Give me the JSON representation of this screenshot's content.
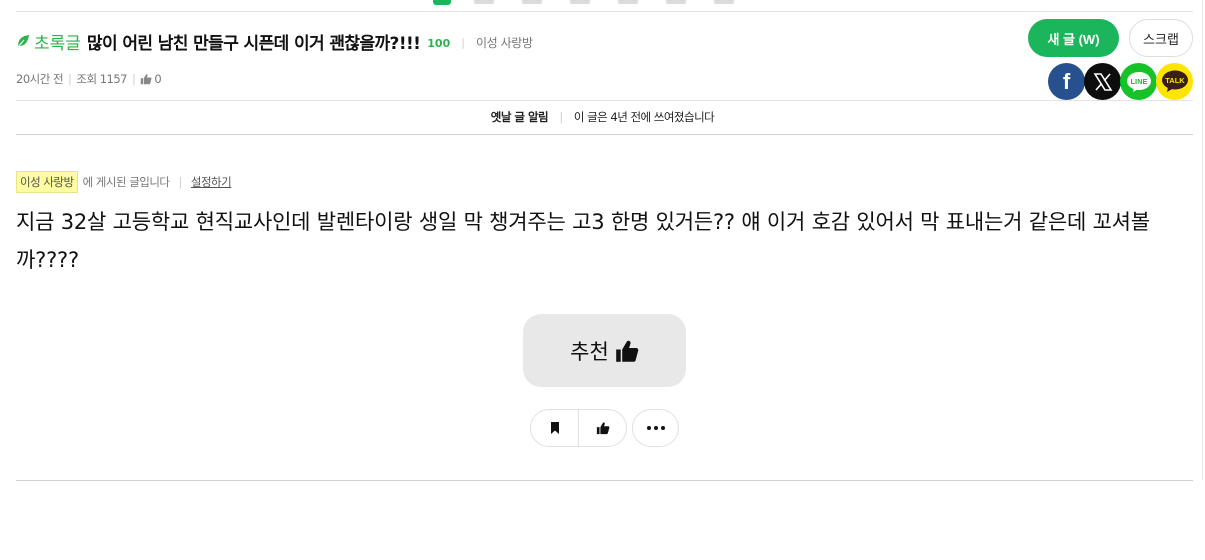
{
  "post": {
    "category": "초록글",
    "title": "많이 어린 남친 만들구 시픈데 이거 괜찮을까?!!!",
    "reply_count": "100",
    "board": "이성 사랑방",
    "time_ago": "20시간 전",
    "views": "조회 1157",
    "likes": "0"
  },
  "header_buttons": {
    "new_post": "새 글 (W)",
    "scrap": "스크랩"
  },
  "share": {
    "facebook": "f",
    "x": "X",
    "line": "LINE",
    "kakao": "TALK"
  },
  "notice": {
    "label": "옛날 글 알림",
    "text": "이 글은 4년 전에 쓰여졌습니다"
  },
  "board_info": {
    "tag": "이성 사랑방",
    "suffix": "에 게시된 글입니다",
    "settings": "설정하기"
  },
  "content": {
    "body": "지금 32살 고등학교 현직교사인데 발렌타이랑 생일 막 챙겨주는 고3 한명 있거든?? 얘 이거 호감 있어서 막 표내는거 같은데 꼬셔볼까????"
  },
  "recommend": {
    "label": "추천"
  },
  "colors": {
    "brand_green": "#1bb55c",
    "category_green": "#2bb24c",
    "facebook": "#27508f",
    "line": "#15c227",
    "kakao": "#fde500",
    "board_tag_bg": "#fdfca0"
  },
  "icons": [
    "leaf-icon",
    "thumbs-up-icon",
    "facebook-icon",
    "x-icon",
    "line-icon",
    "kakaotalk-icon",
    "bookmark-icon",
    "more-icon"
  ]
}
